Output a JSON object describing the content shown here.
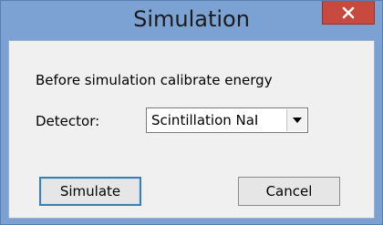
{
  "window": {
    "title": "Simulation",
    "close_label": "×"
  },
  "form": {
    "instruction": "Before simulation calibrate energy",
    "detector_label": "Detector:",
    "detector_value": "Scintillation NaI"
  },
  "buttons": {
    "simulate": "Simulate",
    "cancel": "Cancel"
  },
  "colors": {
    "titlebar": "#7ca2d4",
    "close": "#c84a3f",
    "client": "#f0f0f0",
    "default_button_border": "#3c7fb1"
  },
  "icons": {
    "close": "close-icon",
    "dropdown": "chevron-down-icon"
  }
}
